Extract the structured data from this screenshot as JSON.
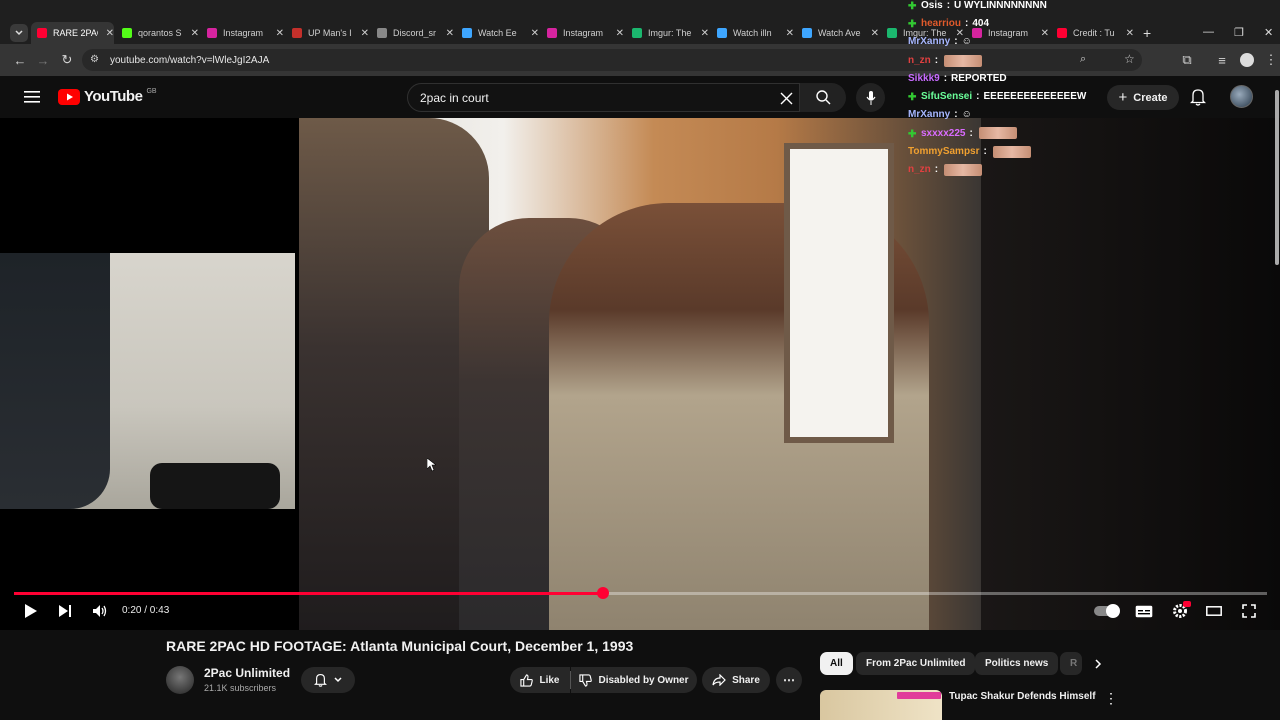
{
  "tabs": [
    {
      "label": "RARE 2PAC",
      "color": "#ff0033",
      "active": true
    },
    {
      "label": "qorantos S",
      "color": "#53fc18"
    },
    {
      "label": "Instagram",
      "color": "#d6249f"
    },
    {
      "label": "UP Man's I",
      "color": "#c4302b"
    },
    {
      "label": "Discord_sr",
      "color": "#888888"
    },
    {
      "label": "Watch Ee",
      "color": "#3ea6ff"
    },
    {
      "label": "Instagram",
      "color": "#d6249f"
    },
    {
      "label": "Imgur: The",
      "color": "#1bb76e"
    },
    {
      "label": "Watch illn",
      "color": "#3ea6ff"
    },
    {
      "label": "Watch Ave",
      "color": "#3ea6ff"
    },
    {
      "label": "Imgur: The",
      "color": "#1bb76e"
    },
    {
      "label": "Instagram",
      "color": "#d6249f"
    },
    {
      "label": "Credit : Tu",
      "color": "#ff0033"
    }
  ],
  "browser": {
    "url": "youtube.com/watch?v=lWleJgI2AJA",
    "new_tab": "+"
  },
  "header": {
    "logo_text": "YouTube",
    "region": "GB",
    "search_value": "2pac in court",
    "create_label": "Create"
  },
  "player": {
    "time_display": "0:20 / 0:43",
    "progress_fraction": 0.47
  },
  "chat": [
    {
      "user": "Osis",
      "user_color": "#ffffff",
      "msg": "U WYLINNNNNNNN",
      "badge": "#32c832"
    },
    {
      "user": "hearriou",
      "user_color": "#e05a2b",
      "msg": "404",
      "badge": "#32c832"
    },
    {
      "user": "MrXanny",
      "user_color": "#a7b7ff",
      "msg": "",
      "emote": "icon"
    },
    {
      "user": "n_zn",
      "user_color": "#e04040",
      "msg": "",
      "emote": "image"
    },
    {
      "user": "Sikkk9",
      "user_color": "#c86bff",
      "msg": "REPORTED"
    },
    {
      "user": "SifuSensei",
      "user_color": "#6bff9a",
      "msg": "EEEEEEEEEEEEEEW",
      "badge": "#32c832"
    },
    {
      "user": "MrXanny",
      "user_color": "#a7b7ff",
      "msg": "",
      "emote": "icon"
    },
    {
      "user": "sxxxx225",
      "user_color": "#d96bff",
      "msg": "",
      "emote": "image",
      "badge": "#32c832"
    },
    {
      "user": "TommySampsr",
      "user_color": "#f0a030",
      "msg": "",
      "emote": "image"
    },
    {
      "user": "n_zn",
      "user_color": "#e04040",
      "msg": "",
      "emote": "image"
    }
  ],
  "video": {
    "title": "RARE 2PAC HD FOOTAGE: Atlanta Municipal Court, December 1, 1993",
    "channel": "2Pac Unlimited",
    "subscribers": "21.1K subscribers",
    "like_label": "Like",
    "dislike_label": "Disabled by Owner",
    "share_label": "Share",
    "more_label": "⋯"
  },
  "chips": [
    {
      "label": "All",
      "selected": true
    },
    {
      "label": "From 2Pac Unlimited"
    },
    {
      "label": "Politics news"
    },
    {
      "label": "R"
    }
  ],
  "recommendation": {
    "title": "Tupac Shakur Defends Himself"
  }
}
